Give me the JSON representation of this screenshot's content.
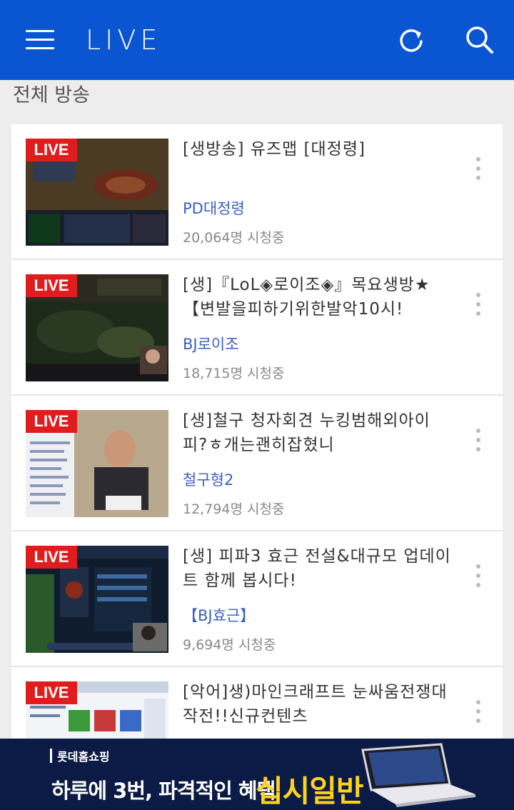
{
  "header": {
    "title": "LIVE",
    "menu_icon": "hamburger-menu-icon",
    "refresh_icon": "refresh-icon",
    "search_icon": "search-icon"
  },
  "section": {
    "title": "전체 방송"
  },
  "live_badge": "LIVE",
  "broadcasts": [
    {
      "title": "[생방송] 유즈맵 [대정령]",
      "channel": "PD대정령",
      "viewers": "20,064명 시청중"
    },
    {
      "title": "[생]『LoL◈로이조◈』목요생방★【변발을피하기위한발악10시!",
      "channel": "BJ로이조",
      "viewers": "18,715명 시청중"
    },
    {
      "title": "[생]철구 청자회견 누킹범해외아이피?ㅎ개는괜히잡혔니",
      "channel": "철구형2",
      "viewers": "12,794명 시청중"
    },
    {
      "title": "[생] 피파3 효근 전설&대규모 업데이트 함께 봅시다!",
      "channel": "【BJ효근】",
      "viewers": "9,694명 시청중"
    },
    {
      "title": "[악어]생)마인크래프트 눈싸움전쟁대작전!!신규컨텐츠",
      "channel": "",
      "viewers": ""
    }
  ],
  "ad": {
    "brand": "롯데홈쇼핑",
    "text": "하루에 3번, 파격적인 혜택",
    "highlight": "십시일반"
  },
  "colors": {
    "appbar": "#0a55d2",
    "live_badge": "#e01c1c",
    "channel": "#3a5fbf",
    "ad_highlight": "#ffd21f"
  }
}
